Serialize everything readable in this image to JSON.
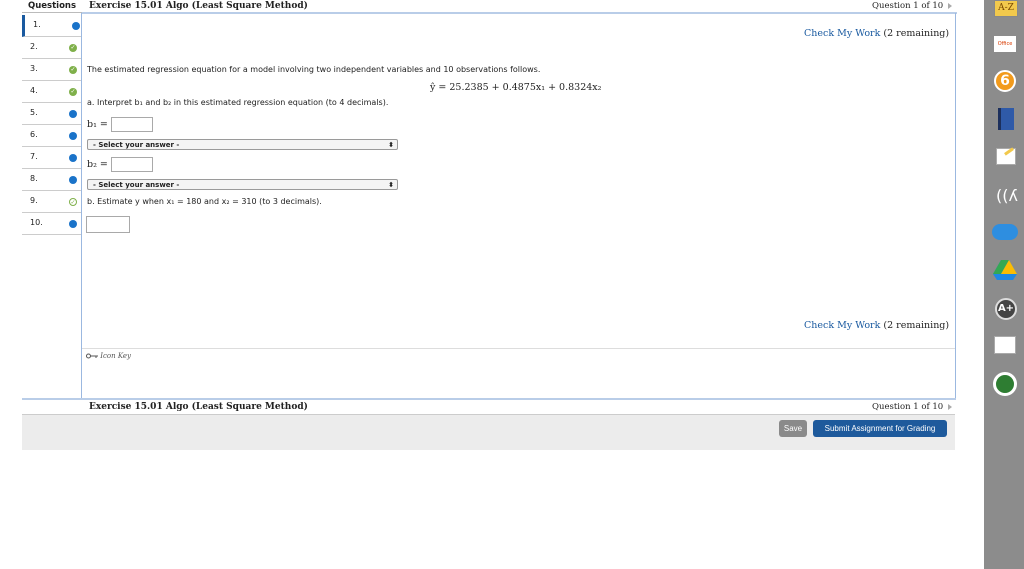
{
  "nav": {
    "header": "Questions",
    "items": [
      {
        "num": "1.",
        "status": "blue"
      },
      {
        "num": "2.",
        "status": "check"
      },
      {
        "num": "3.",
        "status": "check"
      },
      {
        "num": "4.",
        "status": "check"
      },
      {
        "num": "5.",
        "status": "blue"
      },
      {
        "num": "6.",
        "status": "blue"
      },
      {
        "num": "7.",
        "status": "blue"
      },
      {
        "num": "8.",
        "status": "blue"
      },
      {
        "num": "9.",
        "status": "half"
      },
      {
        "num": "10.",
        "status": "blue"
      }
    ]
  },
  "header": {
    "title": "Exercise 15.01 Algo (Least Square Method)",
    "question_num": "Question 1 of 10"
  },
  "check": {
    "label": "Check My Work",
    "remaining": "(2 remaining)"
  },
  "problem": {
    "text": "The estimated regression equation for a model involving two independent variables and 10 observations follows.",
    "equation": "ŷ = 25.2385 + 0.4875x₁ + 0.8324x₂",
    "part_a": "a. Interpret b₁ and b₂ in this estimated regression equation (to 4 decimals).",
    "b1_label": "b₁ =",
    "b2_label": "b₂ =",
    "select_placeholder": "- Select your answer -",
    "part_b": "b. Estimate y when x₁ = 180 and x₂ = 310 (to 3 decimals)."
  },
  "icon_key": "Icon Key",
  "footer": {
    "title": "Exercise 15.01 Algo (Least Square Method)",
    "question_num": "Question 1 of 10",
    "save_label": "Save",
    "submit_label": "Submit Assignment for Grading"
  },
  "dock": {
    "az_label": "A-Z",
    "office_label": "Office"
  }
}
